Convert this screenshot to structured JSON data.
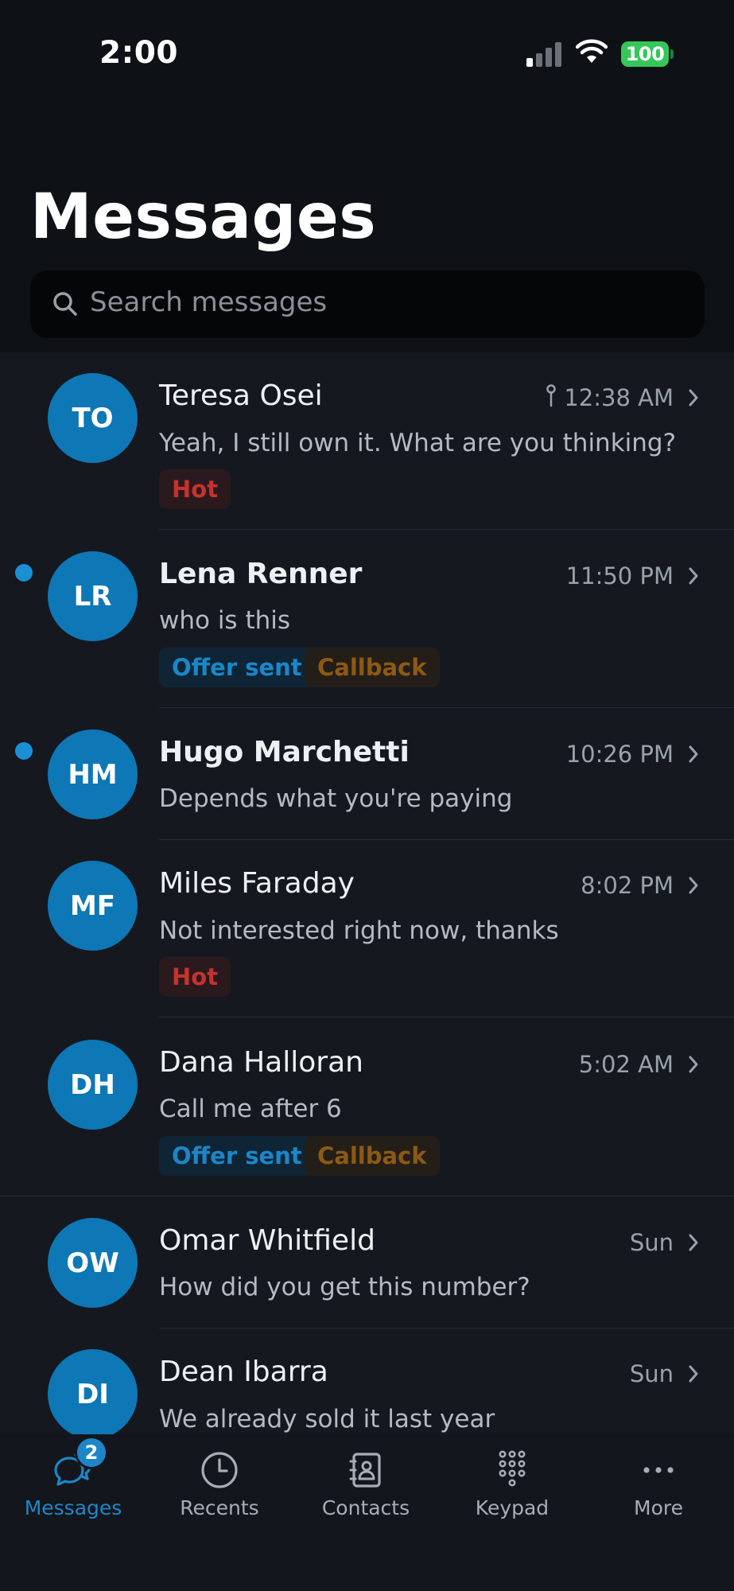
{
  "status_bar": {
    "time": "2:00",
    "battery": "100"
  },
  "header": {
    "title": "Messages"
  },
  "search": {
    "placeholder": "Search messages"
  },
  "conversations": [
    {
      "initials": "TO",
      "name": "Teresa Osei",
      "preview": "Yeah, I still own it. What are you thinking?",
      "time": "12:38 AM",
      "unread": false,
      "pinned": true,
      "tags": [
        "Hot"
      ]
    },
    {
      "initials": "LR",
      "name": "Lena Renner",
      "preview": "who is this",
      "time": "11:50 PM",
      "unread": true,
      "pinned": false,
      "tags": [
        "Offer sent",
        "Callback"
      ]
    },
    {
      "initials": "HM",
      "name": "Hugo Marchetti",
      "preview": "Depends what you're paying",
      "time": "10:26 PM",
      "unread": true,
      "pinned": false,
      "tags": []
    },
    {
      "initials": "MF",
      "name": "Miles Faraday",
      "preview": "Not interested right now, thanks",
      "time": "8:02 PM",
      "unread": false,
      "pinned": false,
      "tags": [
        "Hot"
      ]
    },
    {
      "initials": "DH",
      "name": "Dana Halloran",
      "preview": "Call me after 6",
      "time": "5:02 AM",
      "unread": false,
      "pinned": false,
      "tags": [
        "Offer sent",
        "Callback"
      ]
    },
    {
      "initials": "OW",
      "name": "Omar Whitfield",
      "preview": "How did you get this number?",
      "time": "Sun",
      "unread": false,
      "pinned": false,
      "tags": []
    },
    {
      "initials": "DI",
      "name": "Dean Ibarra",
      "preview": "We already sold it last year",
      "time": "Sun",
      "unread": false,
      "pinned": false,
      "tags": []
    }
  ],
  "tabbar": {
    "messages": {
      "label": "Messages",
      "icon": "chat-bubbles-icon",
      "badge": "2"
    },
    "recents": {
      "label": "Recents",
      "icon": "clock-icon"
    },
    "contacts": {
      "label": "Contacts",
      "icon": "contact-book-icon"
    },
    "keypad": {
      "label": "Keypad",
      "icon": "keypad-icon"
    },
    "more": {
      "label": "More",
      "icon": "ellipsis-icon"
    }
  },
  "colors": {
    "accent": "#1c86c8",
    "avatar": "#0e77b6",
    "hot_tag": "#c6322e",
    "offer_tag": "#1a87c9",
    "callback_tag": "#8c5a14",
    "battery": "#35c759"
  }
}
